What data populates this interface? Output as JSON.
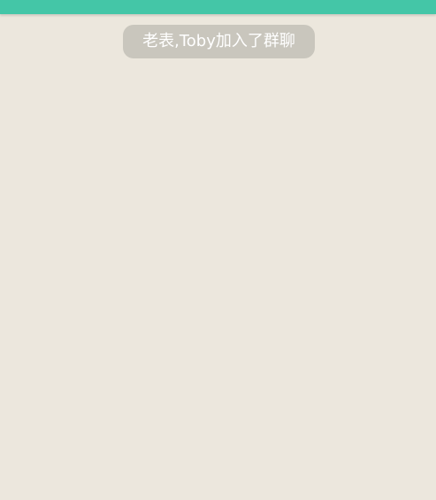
{
  "chat": {
    "system_notice": "老表,Toby加入了群聊"
  },
  "colors": {
    "top_bar": "#44c6a7",
    "background": "#ece7dd",
    "notice_bubble": "#c9c6bd",
    "notice_text": "#ffffff"
  }
}
